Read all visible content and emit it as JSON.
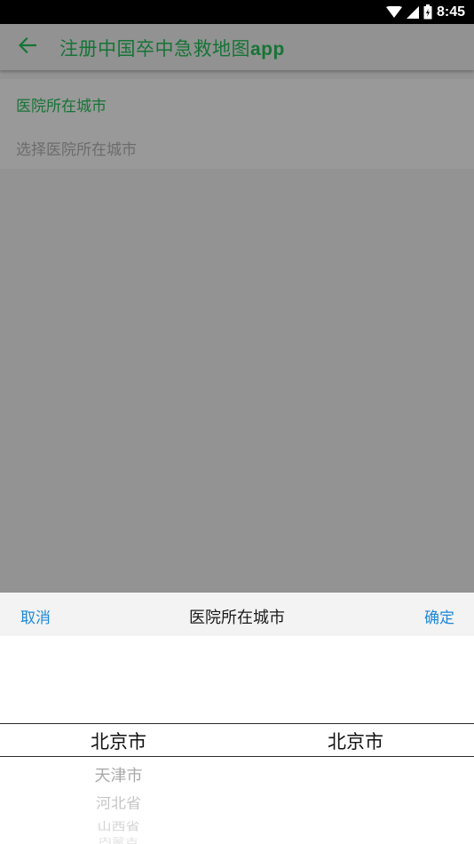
{
  "status_bar": {
    "time": "8:45",
    "icons": [
      "wifi-icon",
      "signal-icon",
      "battery-icon"
    ]
  },
  "app_bar": {
    "back_icon": "arrow-left-icon",
    "title_cn": "注册中国卒中急救地图",
    "title_latin": "app"
  },
  "form": {
    "hospital_city": {
      "label": "医院所在城市",
      "placeholder": "选择医院所在城市"
    }
  },
  "picker": {
    "cancel_label": "取消",
    "title": "医院所在城市",
    "confirm_label": "确定",
    "province": {
      "selected": "北京市",
      "options": [
        "天津市",
        "河北省",
        "山西省",
        "内蒙古"
      ]
    },
    "city": {
      "selected": "北京市"
    }
  },
  "colors": {
    "accent_green": "#167436",
    "link_blue": "#1e88d8",
    "scrim": "#939393"
  }
}
